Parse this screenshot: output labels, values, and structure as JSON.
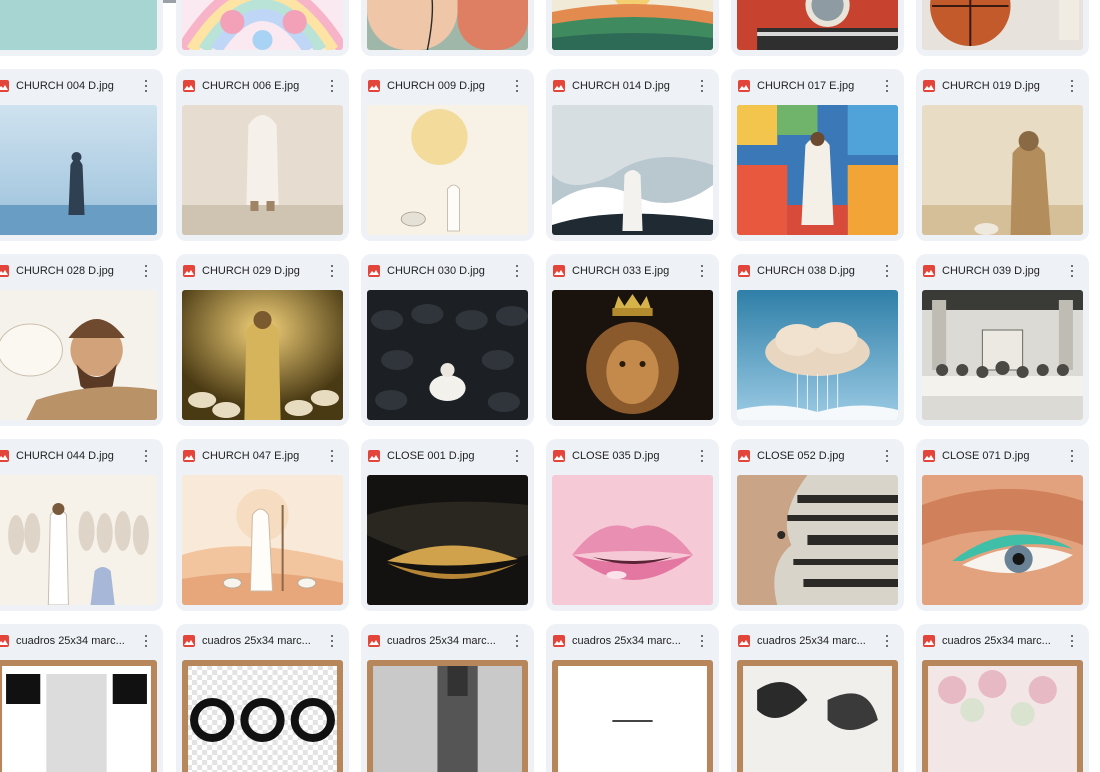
{
  "files": [
    {
      "name": ""
    },
    {
      "name": ""
    },
    {
      "name": ""
    },
    {
      "name": ""
    },
    {
      "name": ""
    },
    {
      "name": ""
    },
    {
      "name": "CHURCH 004 D.jpg"
    },
    {
      "name": "CHURCH 006 E.jpg"
    },
    {
      "name": "CHURCH 009 D.jpg"
    },
    {
      "name": "CHURCH 014 D.jpg"
    },
    {
      "name": "CHURCH 017 E.jpg"
    },
    {
      "name": "CHURCH 019 D.jpg"
    },
    {
      "name": "CHURCH 028 D.jpg"
    },
    {
      "name": "CHURCH 029 D.jpg"
    },
    {
      "name": "CHURCH 030 D.jpg"
    },
    {
      "name": "CHURCH 033 E.jpg"
    },
    {
      "name": "CHURCH 038 D.jpg"
    },
    {
      "name": "CHURCH 039 D.jpg"
    },
    {
      "name": "CHURCH 044 D.jpg"
    },
    {
      "name": "CHURCH 047 E.jpg"
    },
    {
      "name": "CLOSE 001 D.jpg"
    },
    {
      "name": "CLOSE 035 D.jpg"
    },
    {
      "name": "CLOSE 052 D.jpg"
    },
    {
      "name": "CLOSE 071 D.jpg"
    },
    {
      "name": "cuadros 25x34 marc..."
    },
    {
      "name": "cuadros 25x34 marc..."
    },
    {
      "name": "cuadros 25x34 marc..."
    },
    {
      "name": "cuadros 25x34 marc..."
    },
    {
      "name": "cuadros 25x34 marc..."
    },
    {
      "name": "cuadros 25x34 marc..."
    }
  ],
  "icons": {
    "file_type": "image-file-icon",
    "menu": "more-vert-icon"
  },
  "colors": {
    "card_bg": "#eef1f6",
    "file_icon": "#e4453a",
    "page_bg": "#ffffff"
  }
}
